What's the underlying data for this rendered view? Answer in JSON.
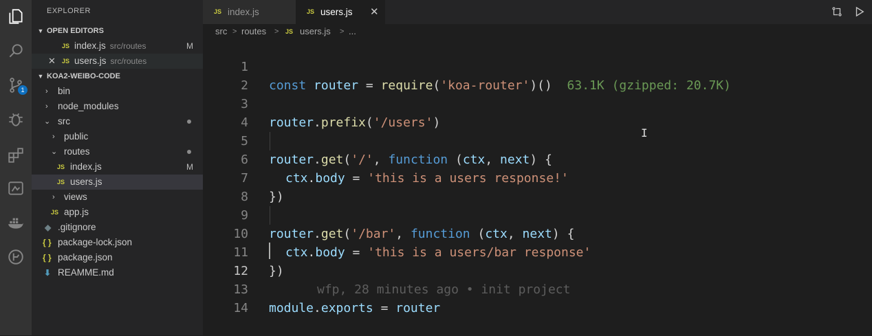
{
  "activity_bar": {
    "icons": [
      "explorer-icon",
      "search-icon",
      "source-control-icon",
      "debug-icon",
      "extensions-icon",
      "remote-explorer-icon",
      "docker-icon",
      "gitlens-icon"
    ],
    "source_control_badge": "1"
  },
  "sidebar": {
    "title": "EXPLORER",
    "open_editors": {
      "title": "OPEN EDITORS",
      "items": [
        {
          "icon": "JS",
          "name": "index.js",
          "desc": "src/routes",
          "mark": "M"
        },
        {
          "icon": "JS",
          "name": "users.js",
          "desc": "src/routes",
          "mark": ""
        }
      ]
    },
    "project": {
      "title": "KOA2-WEIBO-CODE",
      "items": [
        {
          "type": "folder",
          "name": "bin"
        },
        {
          "type": "folder",
          "name": "node_modules"
        },
        {
          "type": "folder",
          "name": "src"
        },
        {
          "type": "folder",
          "name": "public"
        },
        {
          "type": "folder",
          "name": "routes"
        },
        {
          "type": "file",
          "icon": "JS",
          "name": "index.js",
          "mark": "M"
        },
        {
          "type": "file",
          "icon": "JS",
          "name": "users.js"
        },
        {
          "type": "folder",
          "name": "views"
        },
        {
          "type": "file",
          "icon": "JS",
          "name": "app.js"
        },
        {
          "type": "file",
          "icon": "◆",
          "name": ".gitignore"
        },
        {
          "type": "file",
          "icon": "{ }",
          "name": "package-lock.json"
        },
        {
          "type": "file",
          "icon": "{ }",
          "name": "package.json"
        },
        {
          "type": "file",
          "icon": "⬇",
          "name": "REAMME.md"
        }
      ]
    }
  },
  "tabs": [
    {
      "icon": "JS",
      "label": "index.js"
    },
    {
      "icon": "JS",
      "label": "users.js",
      "close": "✕"
    }
  ],
  "toolbar_icons": [
    "compare-changes-icon",
    "run-icon"
  ],
  "breadcrumb": {
    "items": [
      "src",
      "routes",
      "users.js",
      "..."
    ],
    "file_icon": "JS",
    "separator": ">"
  },
  "editor": {
    "lines": [
      "1",
      "2",
      "3",
      "4",
      "5",
      "6",
      "7",
      "8",
      "9",
      "10",
      "11",
      "12",
      "13",
      "14"
    ],
    "active_line": "12",
    "code": {
      "l1": [
        "const",
        "router",
        "=",
        "require",
        "(",
        "'koa-router'",
        ")()"
      ],
      "import_cost": "63.1K (gzipped: 20.7K)",
      "l3": [
        "router",
        ".",
        "prefix",
        "(",
        "'/users'",
        ")"
      ],
      "l5": [
        "router",
        ".",
        "get",
        "(",
        "'/'",
        ", ",
        "function",
        " (",
        "ctx",
        ", ",
        "next",
        ") {"
      ],
      "l6": [
        "ctx",
        ".",
        "body",
        " = ",
        "'this is a users response!'"
      ],
      "l7": "})",
      "l9": [
        "router",
        ".",
        "get",
        "(",
        "'/bar'",
        ", ",
        "function",
        " (",
        "ctx",
        ", ",
        "next",
        ") {"
      ],
      "l10": [
        "ctx",
        ".",
        "body",
        " = ",
        "'this is a users/bar response'"
      ],
      "l11": "})",
      "blame": "wfp, 28 minutes ago • init project",
      "l13": [
        "module",
        ".",
        "exports",
        " = ",
        "router"
      ]
    }
  }
}
